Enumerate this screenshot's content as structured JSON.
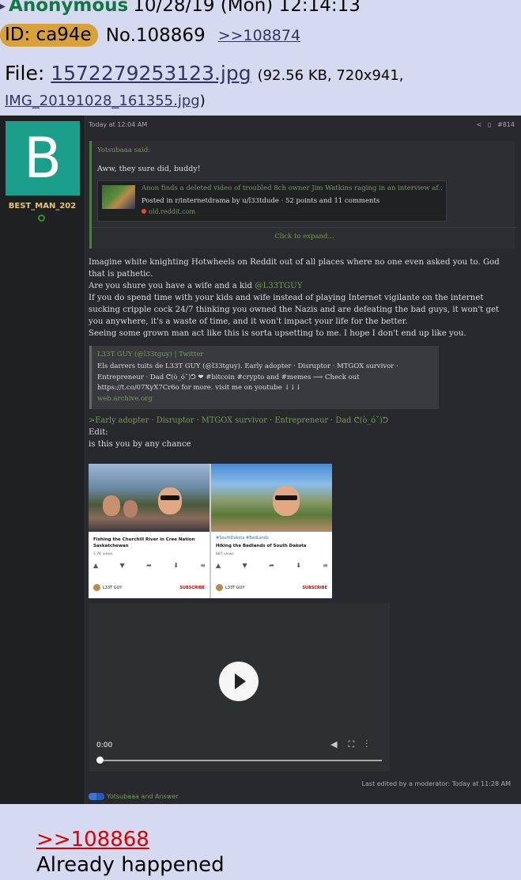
{
  "header": {
    "arrow": "▸",
    "name": "Anonymous",
    "datetime": "10/28/19 (Mon) 12:14:13",
    "id_label": "ID: ca94e",
    "post_no": "No.108869",
    "backlink": ">>108874"
  },
  "file": {
    "prefix": "File: ",
    "filename": "1572279253123.jpg",
    "meta": "(92.56 KB, 720x941,",
    "original_name": "IMG_20191028_161355.jpg",
    "close": ")"
  },
  "screenshot": {
    "avatar_letter": "B",
    "username": "BEST_MAN_202",
    "timestamp": "Today at 12:04 AM",
    "post_number": "#814",
    "quote": {
      "said": "Yotsubaaa said:",
      "text": "Aww, they sure did, buddy!",
      "embed_title": "Anon finds a deleted video of troubled 8ch owner Jim Watkins raging in an interview af...",
      "embed_sub": "Posted in r/internetdrama by u/l33tdude · 52 points and 11 comments",
      "embed_site": "old.reddit.com",
      "expand": "Click to expand..."
    },
    "body": [
      "Imagine white knighting Hotwheels on Reddit out of all places where no one even asked you to. God that is pathetic.",
      "Are you shure you have a wife and a kid",
      "If you do spend time with your kids and wife instead of playing Internet vigilante on the internet sucking cripple cock 24/7 thinking you owned the Nazis and are defeating the bad guys, it won't get you anywhere, it's a waste of time, and it won't impact your life for the better.",
      "Seeing some grown man act like this is sorta upsetting to me. I hope I don't end up like you."
    ],
    "mention": "@L33TGUY",
    "twitter": {
      "title": "L33T GUY (@l33tguy) | Twitter",
      "desc": "Els darrers tuits de L33T GUY (@l33tguy). Early adopter · Disruptor · MTGOX survivor · Entrepreneur · Dad ᕦ(ò_óˇ)ᕤ ❤ #bitcoin #crypto and #memes ⟶ Check out https://t.co/07XyX7Cr6o for more. visit me on youtube ↓↓↓",
      "site": "web.archive.org"
    },
    "greentext": ">Early adopter · Disruptor · MTGOX survivor · Entrepreneur · Dad ᕦ(ò_óˇ)ᕤ",
    "edit_label": "Edit:",
    "edit_text": "is this you by any chance",
    "videos": [
      {
        "tag": "",
        "title": "Fishing the Churchill River in Cree Nation Saskatchewan",
        "views": "1.7K views",
        "channel": "L33T GUY",
        "subscribe": "SUBSCRIBE"
      },
      {
        "tag": "#SouthDakota #BadLands",
        "title": "Hiking the Badlands of South Dakota",
        "views": "887 views",
        "channel": "L33T GUY",
        "subscribe": "SUBSCRIBE"
      }
    ],
    "video_time": "0:00",
    "edited_note": "Last edited by a moderator: Today at 11:28 AM",
    "reactions": "Yotsubaaa and Answer"
  },
  "reply": {
    "link": ">>108868",
    "text": "Already happened"
  }
}
